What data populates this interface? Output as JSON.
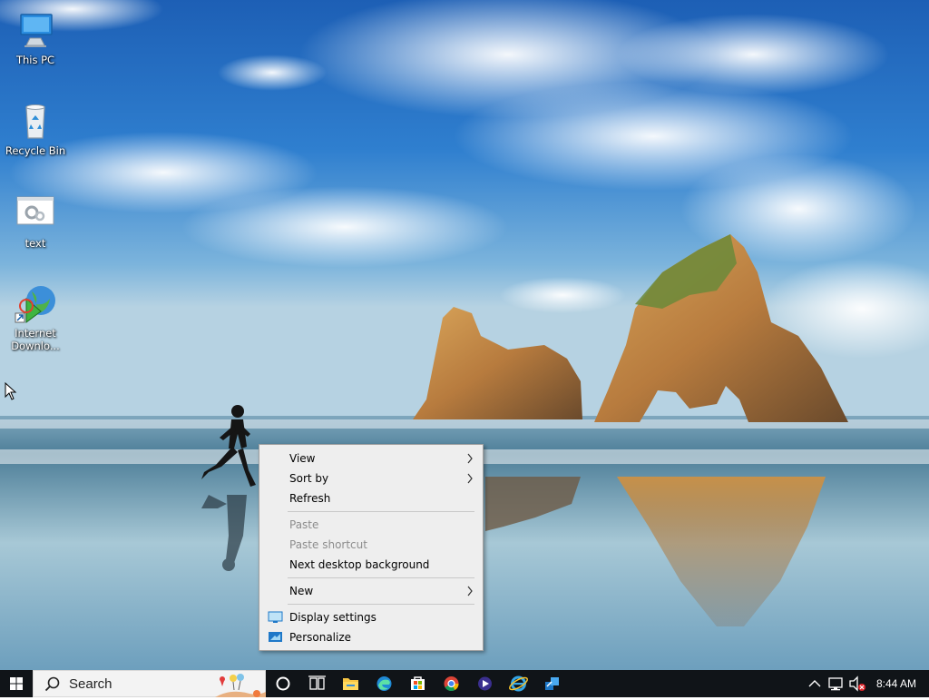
{
  "desktop": {
    "icons": [
      {
        "label": "This PC",
        "icon": "this-pc-icon"
      },
      {
        "label": "Recycle Bin",
        "icon": "recycle-bin-icon"
      },
      {
        "label": "text",
        "icon": "text-file-icon"
      },
      {
        "label": "Internet Downlo...",
        "icon": "internet-download-manager-icon"
      }
    ]
  },
  "context_menu": {
    "items": [
      {
        "label": "View",
        "submenu": true,
        "enabled": true
      },
      {
        "label": "Sort by",
        "submenu": true,
        "enabled": true
      },
      {
        "label": "Refresh",
        "enabled": true
      },
      {
        "label": "Paste",
        "enabled": false
      },
      {
        "label": "Paste shortcut",
        "enabled": false
      },
      {
        "label": "Next desktop background",
        "enabled": true
      },
      {
        "label": "New",
        "submenu": true,
        "enabled": true
      },
      {
        "label": "Display settings",
        "icon": "display-settings-icon",
        "enabled": true
      },
      {
        "label": "Personalize",
        "icon": "personalize-icon",
        "enabled": true
      }
    ]
  },
  "taskbar": {
    "search_placeholder": "Search",
    "apps": [
      "cortana-icon",
      "task-view-icon",
      "file-explorer-icon",
      "edge-icon",
      "store-icon",
      "chrome-icon",
      "media-player-icon",
      "internet-explorer-icon",
      "quick-assist-icon"
    ],
    "tray": {
      "time": "8:44 AM",
      "icons": [
        "show-hidden-icons-chevron",
        "network-icon",
        "volume-muted-icon"
      ]
    }
  },
  "colors": {
    "taskbar_bg": "#101418",
    "menu_bg": "#eeeeee",
    "menu_disabled_text": "#8d8d8d",
    "accent_blue": "#0078d7"
  }
}
